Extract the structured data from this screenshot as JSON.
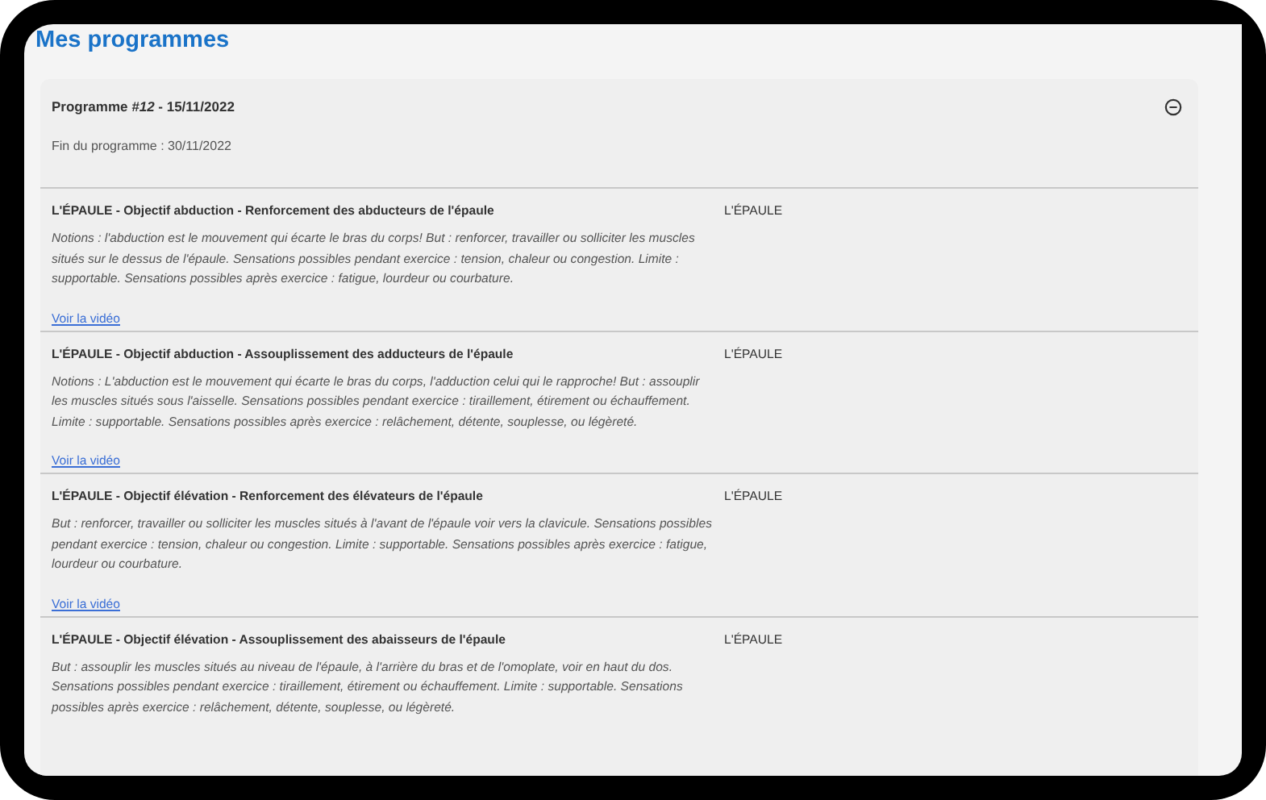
{
  "page_title": "Mes programmes",
  "program": {
    "title": "Programme *#12* - 15/11/2022",
    "expanded": true,
    "end_date": "Fin du programme : 30/11/2022",
    "exercises": [
      {
        "title": "L'ÉPAULE - Objectif abduction - Renforcement des abducteurs de l'épaule",
        "description": "Notions : l'abduction est le mouvement qui écarte le bras du corps! But : renforcer, travailler ou solliciter les muscles situés sur le dessus de l'épaule. Sensations possibles pendant exercice : tension, chaleur ou congestion. Limite : supportable. Sensations possibles après exercice : fatigue, lourdeur ou courbature.",
        "link": "Voir la vidéo",
        "zone": "L'ÉPAULE"
      },
      {
        "title": "L'ÉPAULE - Objectif abduction - Assouplissement des adducteurs de l'épaule",
        "description": "Notions : L'abduction est le mouvement qui écarte le bras du corps, l'adduction celui qui le rapproche! But : assouplir les muscles situés sous l'aisselle. Sensations possibles pendant exercice : tiraillement, étirement ou échauffement. Limite : supportable. Sensations possibles après exercice : relâchement, détente, souplesse, ou légèreté.",
        "link": "Voir la vidéo",
        "zone": "L'ÉPAULE"
      },
      {
        "title": "L'ÉPAULE - Objectif élévation - Renforcement des élévateurs de l'épaule",
        "description": "But : renforcer, travailler ou solliciter les muscles situés à l'avant de l'épaule voir vers la clavicule. Sensations possibles pendant exercice : tension, chaleur ou congestion. Limite : supportable. Sensations possibles après exercice : fatigue, lourdeur ou courbature.",
        "link": "Voir la vidéo",
        "zone": "L'ÉPAULE"
      },
      {
        "title": "L'ÉPAULE - Objectif élévation - Assouplissement des abaisseurs de l'épaule",
        "description": "But : assouplir les muscles situés au niveau de l'épaule, à l'arrière du bras et de l'omoplate, voir en haut du dos. Sensations possibles pendant exercice : tiraillement, étirement ou échauffement. Limite : supportable. Sensations possibles après exercice : relâchement, détente, souplesse, ou légèreté.",
        "zone": "L'ÉPAULE"
      }
    ]
  }
}
